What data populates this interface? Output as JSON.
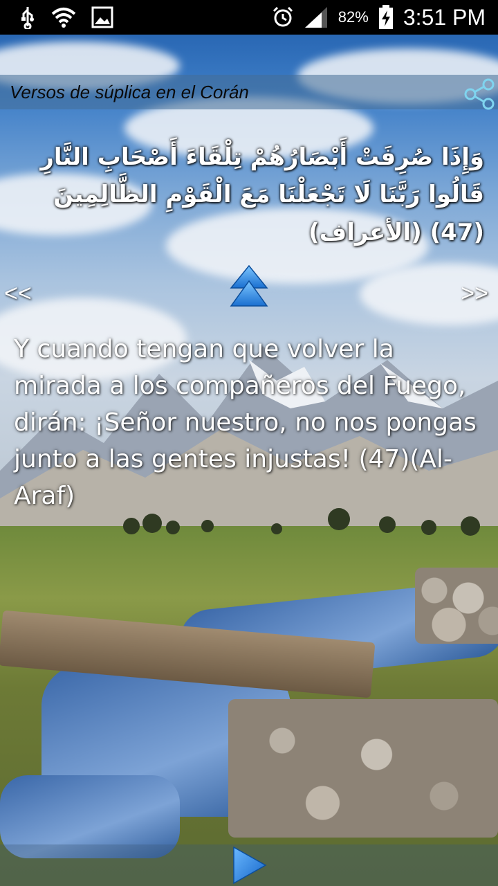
{
  "status_bar": {
    "battery_percent": "82%",
    "time": "3:51 PM",
    "icons": [
      "usb-icon",
      "wifi-icon",
      "image-icon",
      "alarm-icon",
      "signal-icon",
      "battery-charging-icon"
    ]
  },
  "header": {
    "title": "Versos de súplica en el Corán",
    "share_icon": "share-icon"
  },
  "verse": {
    "arabic": "وَإِذَا صُرِفَتْ أَبْصَارُهُمْ تِلْقَاءَ أَصْحَابِ النَّارِ قَالُوا رَبَّنَا لَا تَجْعَلْنَا مَعَ الْقَوْمِ الظَّالِمِينَ (47) (الأعراف)",
    "translation": "Y cuando tengan que volver la mirada a los compañeros del Fuego, dirán: ¡Señor nuestro, no nos pongas junto a las gentes injustas! (47)(Al-Araf)"
  },
  "navigation": {
    "prev_label": "<<",
    "next_label": ">>",
    "up_icon": "double-chevron-up-icon",
    "play_icon": "play-icon"
  },
  "colors": {
    "status_bar_bg": "#000000",
    "title_bar_bg": "#466e96",
    "text": "#ffffff",
    "accent": "#2a8fe0"
  }
}
